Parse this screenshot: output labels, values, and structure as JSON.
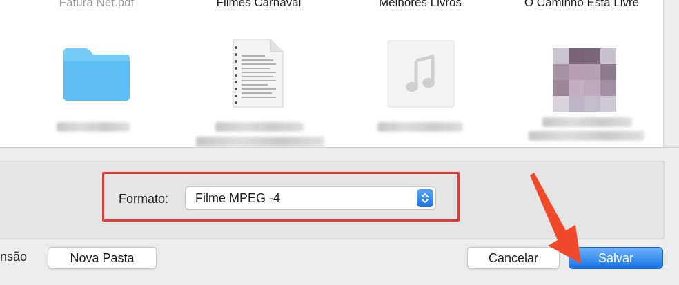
{
  "files": [
    {
      "name": "Fatura Net.pdf",
      "icon": "folder-icon",
      "muted": true
    },
    {
      "name": "Filmes Carnaval",
      "icon": "document-icon",
      "muted": false
    },
    {
      "name": "Melhores Livros",
      "icon": "music-file-icon",
      "muted": false
    },
    {
      "name": "O Caminho Está Livre",
      "icon": "image-thumbnail-icon",
      "muted": false
    }
  ],
  "format": {
    "label": "Formato:",
    "value": "Filme MPEG -4"
  },
  "buttons": {
    "extension_partial": "nsão",
    "new_folder": "Nova Pasta",
    "cancel": "Cancelar",
    "save": "Salvar"
  },
  "colors": {
    "highlight": "#e8392e",
    "primary_button": "#1b73e6",
    "arrow": "#f04a2a",
    "folder": "#5cc3f6"
  }
}
